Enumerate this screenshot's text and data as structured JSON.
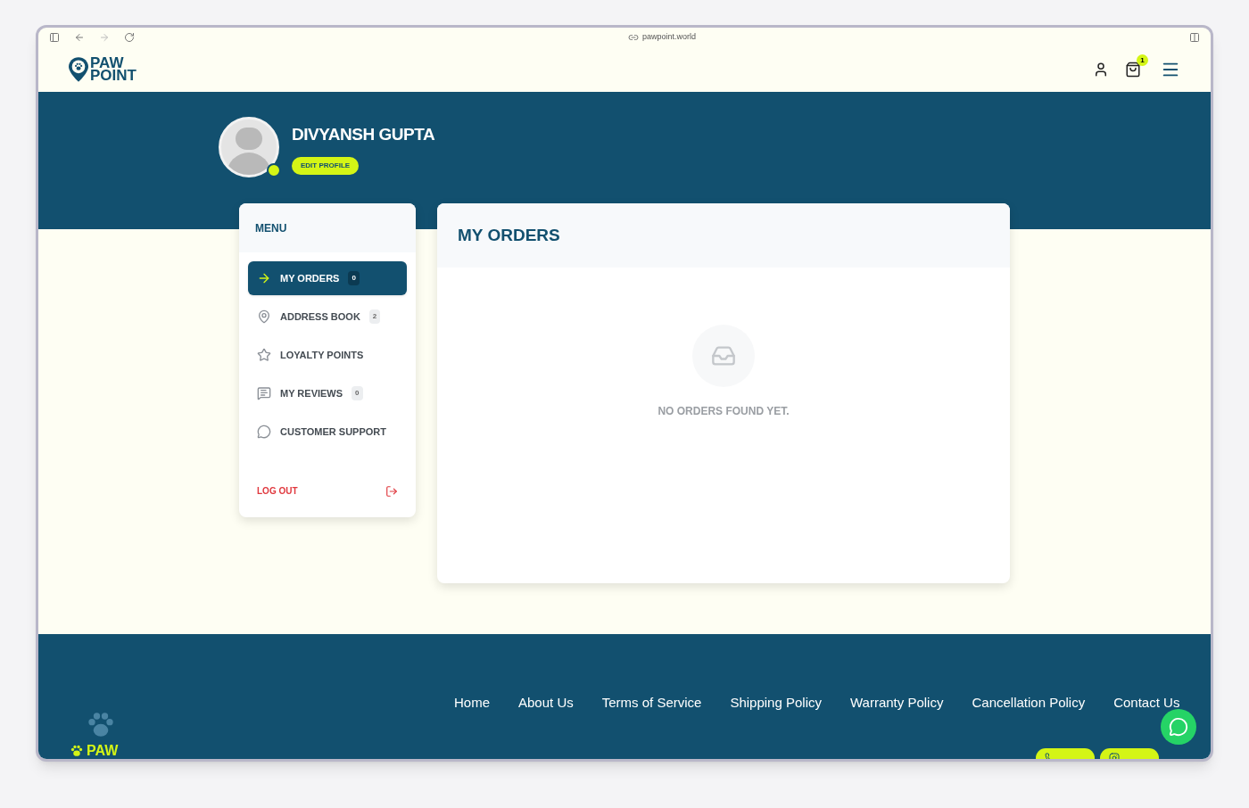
{
  "browser": {
    "url": "pawpoint.world"
  },
  "header": {
    "logo": [
      "PAW",
      "POINT"
    ],
    "cart_count": "1"
  },
  "profile": {
    "name": "DIVYANSH GUPTA",
    "edit_button": "EDIT PROFILE",
    "online": true
  },
  "menu": {
    "title": "MENU",
    "items": [
      {
        "kind": "orders",
        "label": "MY ORDERS",
        "count": "0",
        "selected": true
      },
      {
        "kind": "address",
        "label": "ADDRESS BOOK",
        "count": "2",
        "selected": false
      },
      {
        "kind": "loyalty",
        "label": "LOYALTY POINTS",
        "selected": false
      },
      {
        "kind": "reviews",
        "label": "MY REVIEWS",
        "count": "0",
        "selected": false
      },
      {
        "kind": "support",
        "label": "CUSTOMER SUPPORT",
        "selected": false
      }
    ],
    "logout": "LOG OUT"
  },
  "orders": {
    "title": "MY ORDERS",
    "empty_message": "NO ORDERS FOUND YET."
  },
  "footer": {
    "logo": [
      "PAW"
    ],
    "links": [
      "Home",
      "About Us",
      "Terms of Service",
      "Shipping Policy",
      "Warranty Policy",
      "Cancellation Policy",
      "Contact Us"
    ]
  }
}
